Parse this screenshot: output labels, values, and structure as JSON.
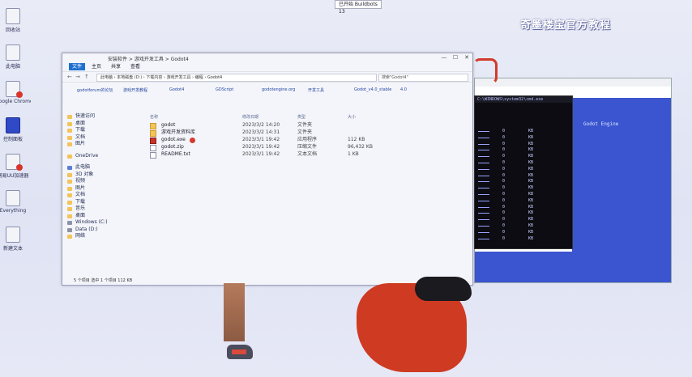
{
  "banner": "奇墨楼宝官方教程",
  "top_chip": "已开始 Buildbots 13",
  "desktop_icons": [
    {
      "label": "回收站",
      "style": "plain"
    },
    {
      "label": "此电脑",
      "style": "plain"
    },
    {
      "label": "Google Chrome",
      "style": "red"
    },
    {
      "label": "控制面板",
      "style": "blue"
    },
    {
      "label": "网易UU加速器",
      "style": "red"
    },
    {
      "label": "Everything",
      "style": "plain"
    },
    {
      "label": "新建文本",
      "style": "plain"
    }
  ],
  "explorer": {
    "title": "安装软件 > 游戏开发工具 > Godot4",
    "controls": [
      "—",
      "☐",
      "✕"
    ],
    "ribbon_tabs": [
      "文件",
      "主页",
      "共享",
      "查看"
    ],
    "address": "此电脑 › 本地磁盘 (D:) › 下载内容 › 游戏开发工具 › 编程 › Godot4",
    "search_placeholder": "搜索\"Godot4\"",
    "breadcrumbs": [
      "godotforum的论坛",
      "游戏开发教程",
      "Godot4",
      "GDScript",
      "godotengine.org",
      "开发工具",
      "Godot_v4.0_stable",
      "4.0"
    ],
    "sidebar": [
      {
        "label": "快速访问",
        "icon": "star"
      },
      {
        "label": "桌面",
        "icon": "folder"
      },
      {
        "label": "下载",
        "icon": "folder"
      },
      {
        "label": "文档",
        "icon": "folder"
      },
      {
        "label": "图片",
        "icon": "folder"
      },
      {
        "label": "OneDrive",
        "icon": "cloud"
      },
      {
        "label": "此电脑",
        "icon": "pc"
      },
      {
        "label": "3D 对象",
        "icon": "folder"
      },
      {
        "label": "视频",
        "icon": "folder"
      },
      {
        "label": "图片",
        "icon": "folder"
      },
      {
        "label": "文档",
        "icon": "folder"
      },
      {
        "label": "下载",
        "icon": "folder"
      },
      {
        "label": "音乐",
        "icon": "folder"
      },
      {
        "label": "桌面",
        "icon": "folder"
      },
      {
        "label": "Windows (C:)",
        "icon": "drive"
      },
      {
        "label": "Data (D:)",
        "icon": "drive"
      },
      {
        "label": "网络",
        "icon": "network"
      }
    ],
    "columns": [
      "名称",
      "修改日期",
      "类型",
      "大小"
    ],
    "files": [
      {
        "name": "godot",
        "date": "2023/3/2 14:20",
        "type": "文件夹",
        "size": "",
        "icon": "folder"
      },
      {
        "name": "游戏开发资料库",
        "date": "2023/3/2 14:31",
        "type": "文件夹",
        "size": "",
        "icon": "folder"
      },
      {
        "name": "godot.exe",
        "date": "2023/3/1 19:42",
        "type": "应用程序",
        "size": "112 KB",
        "icon": "exe"
      },
      {
        "name": "godot.zip",
        "date": "2023/3/1 19:42",
        "type": "压缩文件",
        "size": "96,432 KB",
        "icon": "file"
      },
      {
        "name": "README.txt",
        "date": "2023/3/1 19:42",
        "type": "文本文档",
        "size": "1 KB",
        "icon": "file"
      }
    ],
    "status": "5 个项目   选中 1 个项目 112 KB"
  },
  "terminal": {
    "header": "C:\\WINDOWS\\system32\\cmd.exe",
    "rows": [
      [
        "0",
        "KB"
      ],
      [
        "0",
        "KB"
      ],
      [
        "0",
        "KB"
      ],
      [
        "0",
        "KB"
      ],
      [
        "0",
        "KB"
      ],
      [
        "0",
        "KB"
      ],
      [
        "0",
        "KB"
      ],
      [
        "0",
        "KB"
      ],
      [
        "0",
        "KB"
      ],
      [
        "0",
        "KB"
      ],
      [
        "0",
        "KB"
      ],
      [
        "0",
        "KB"
      ],
      [
        "0",
        "KB"
      ],
      [
        "0",
        "KB"
      ],
      [
        "0",
        "KB"
      ],
      [
        "0",
        "KB"
      ],
      [
        "0",
        "KB"
      ],
      [
        "0",
        "KB"
      ]
    ]
  },
  "blue_window_text": "Godot Engine"
}
